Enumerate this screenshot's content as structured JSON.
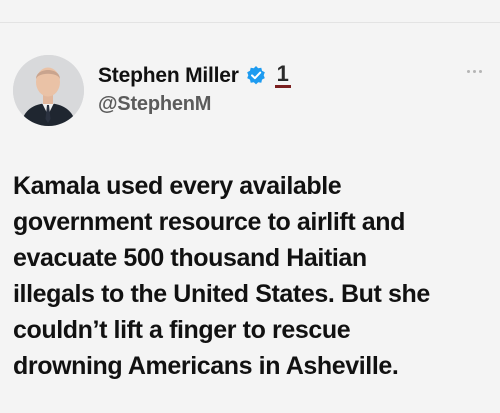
{
  "author": {
    "name": "Stephen Miller",
    "handle": "@StephenM",
    "affiliation_badge": "1"
  },
  "tweet": {
    "text": "Kamala used every available\ngovernment resource to airlift and\nevacuate 500 thousand Haitian\nillegals to the United States. But she\ncouldn’t lift a finger to rescue\ndrowning Americans in Asheville."
  },
  "icons": {
    "verified": "verified-checkmark-icon",
    "more": "more-options-icon"
  },
  "colors": {
    "verified_blue": "#1d9bf0",
    "text": "#111111",
    "handle_gray": "#5b5b5b",
    "background": "#f4f4f4"
  }
}
